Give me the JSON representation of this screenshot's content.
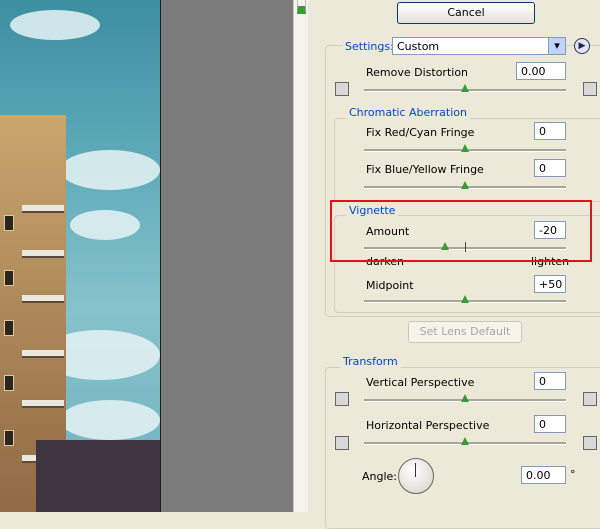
{
  "cancel_label": "Cancel",
  "settings": {
    "label": "Settings:",
    "value": "Custom"
  },
  "remove_distortion": {
    "label": "Remove Distortion",
    "value": "0.00"
  },
  "chromatic": {
    "title": "Chromatic Aberration",
    "red_cyan": {
      "label": "Fix Red/Cyan Fringe",
      "value": "0"
    },
    "blue_yellow": {
      "label": "Fix Blue/Yellow Fringe",
      "value": "0"
    }
  },
  "vignette": {
    "title": "Vignette",
    "amount": {
      "label": "Amount",
      "value": "-20",
      "left_caption": "darken",
      "right_caption": "lighten"
    },
    "midpoint": {
      "label": "Midpoint",
      "value": "+50"
    }
  },
  "set_lens_default_label": "Set Lens Default",
  "transform": {
    "title": "Transform",
    "vertical": {
      "label": "Vertical Perspective",
      "value": "0"
    },
    "horizontal": {
      "label": "Horizontal Perspective",
      "value": "0"
    },
    "angle": {
      "label": "Angle:",
      "value": "0.00",
      "unit": "°"
    }
  },
  "icons": [
    "barrel-distortion-icon",
    "pincushion-icon",
    "settings-menu-icon",
    "vertical-perspective-left-icon",
    "vertical-perspective-right-icon",
    "horizontal-perspective-left-icon",
    "horizontal-perspective-right-icon",
    "angle-dial"
  ]
}
